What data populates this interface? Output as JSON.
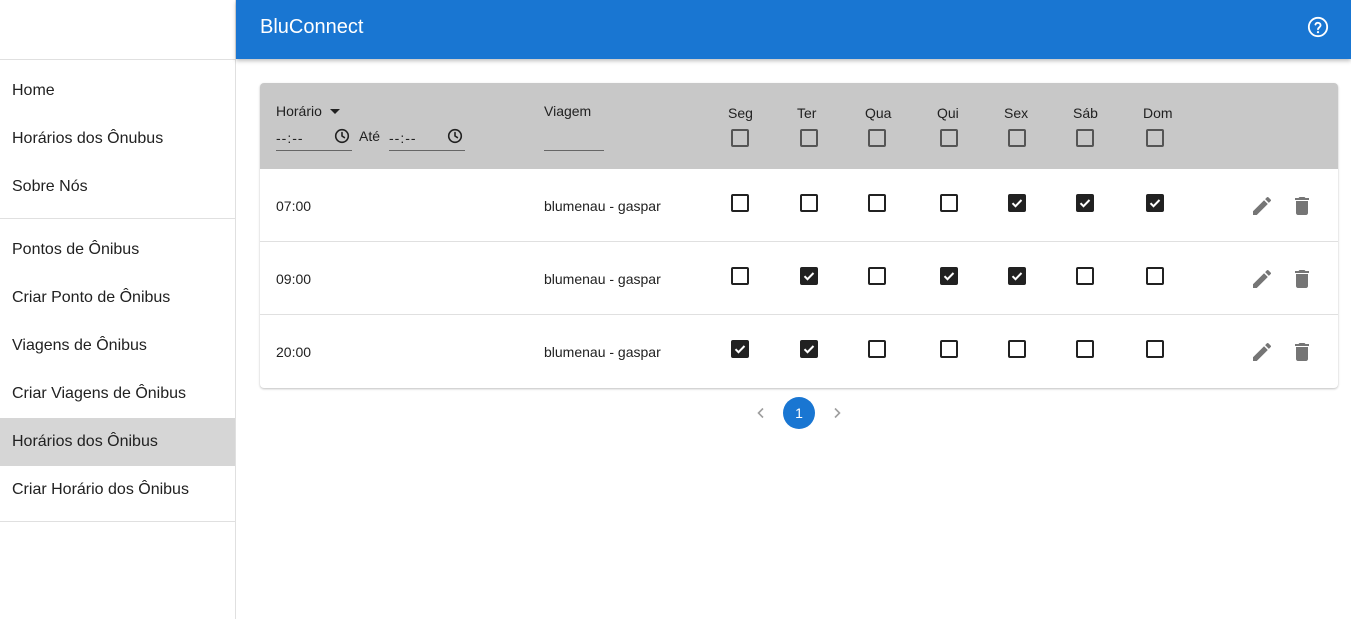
{
  "app": {
    "title": "BluConnect",
    "help_icon": "help-circle-icon"
  },
  "sidebar": {
    "groups": [
      [
        "Home",
        "Horários dos Ônubus",
        "Sobre Nós"
      ],
      [
        "Pontos de Ônibus",
        "Criar Ponto de Ônibus",
        "Viagens de Ônibus",
        "Criar Viagens de Ônibus",
        "Horários dos Ônibus",
        "Criar Horário dos Ônibus"
      ]
    ],
    "active": "Horários dos Ônibus"
  },
  "table": {
    "headers": {
      "horario": "Horário",
      "ate": "Até",
      "viagem": "Viagem",
      "days": [
        "Seg",
        "Ter",
        "Qua",
        "Qui",
        "Sex",
        "Sáb",
        "Dom"
      ]
    },
    "filters": {
      "from_placeholder": "--:--",
      "to_placeholder": "--:--",
      "viagem_value": ""
    },
    "rows": [
      {
        "horario": "07:00",
        "viagem": "blumenau - gaspar",
        "days": [
          false,
          false,
          false,
          false,
          true,
          true,
          true
        ]
      },
      {
        "horario": "09:00",
        "viagem": "blumenau - gaspar",
        "days": [
          false,
          true,
          false,
          true,
          true,
          false,
          false
        ]
      },
      {
        "horario": "20:00",
        "viagem": "blumenau - gaspar",
        "days": [
          true,
          true,
          false,
          false,
          false,
          false,
          false
        ]
      }
    ]
  },
  "pagination": {
    "current_page": "1"
  },
  "colors": {
    "primary": "#1976d2",
    "header_bg": "#c8c8c8",
    "active_nav": "#d6d6d6"
  }
}
